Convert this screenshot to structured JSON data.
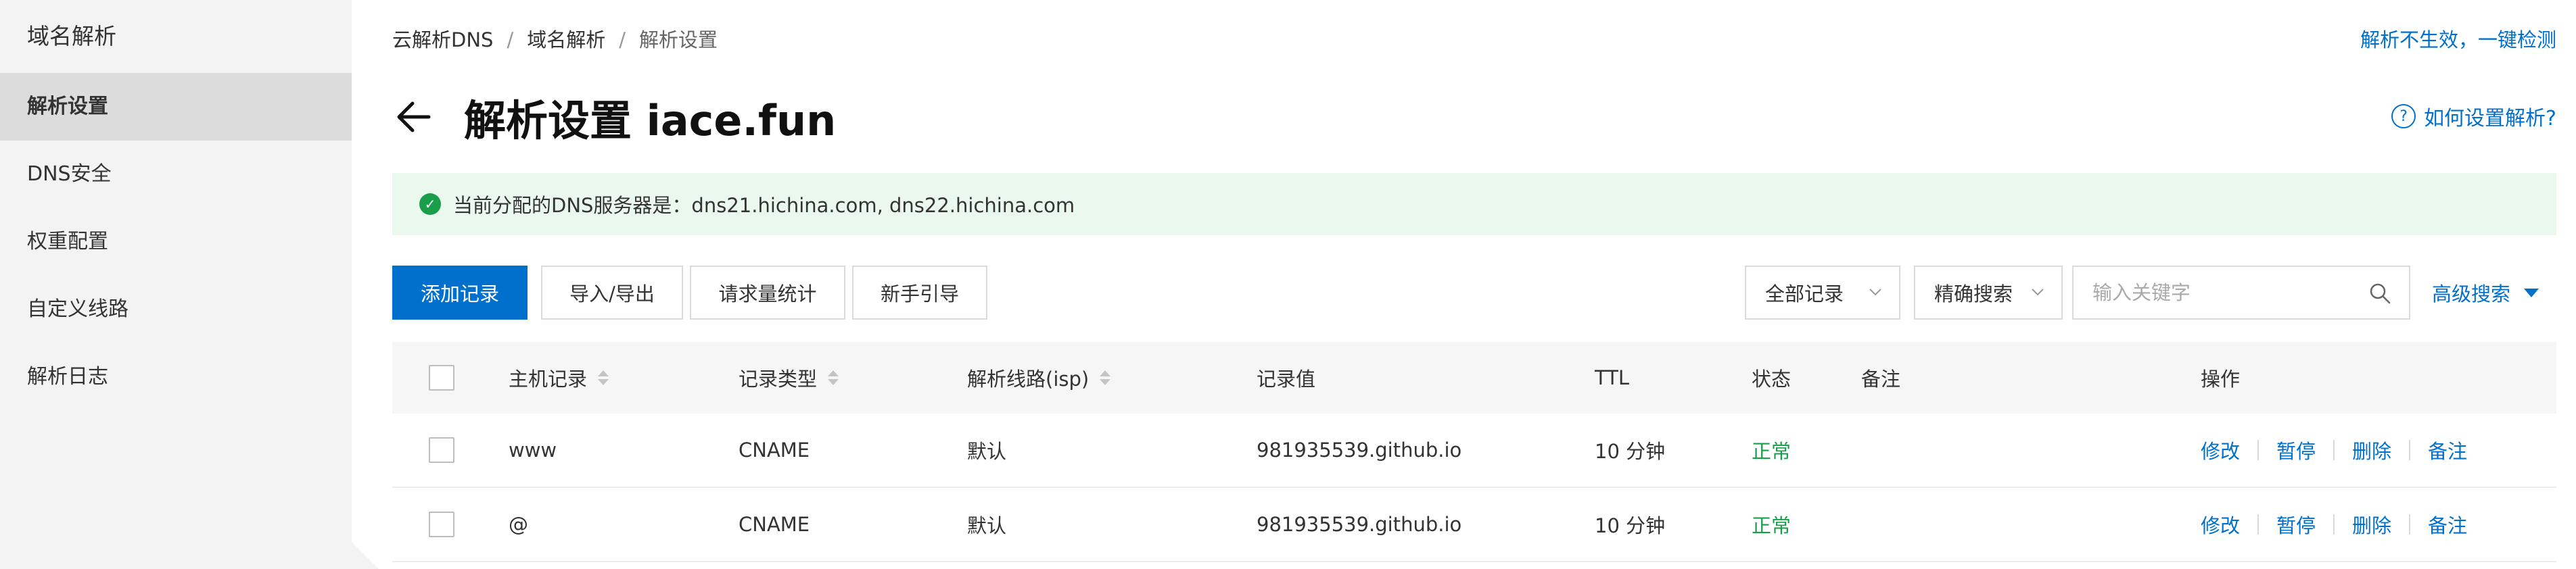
{
  "sidebar": {
    "title": "域名解析",
    "items": [
      {
        "label": "解析设置",
        "active": true
      },
      {
        "label": "DNS安全",
        "active": false
      },
      {
        "label": "权重配置",
        "active": false
      },
      {
        "label": "自定义线路",
        "active": false
      },
      {
        "label": "解析日志",
        "active": false
      }
    ]
  },
  "breadcrumb": {
    "items": [
      "云解析DNS",
      "域名解析",
      "解析设置"
    ],
    "separator": "/"
  },
  "header": {
    "check_link": "解析不生效，一键检测",
    "title": "解析设置 iace.fun",
    "help_icon": "?",
    "help_link": "如何设置解析?",
    "back_icon": "arrow-left-icon"
  },
  "notice": {
    "icon": "check-circle-icon",
    "icon_glyph": "✓",
    "text": "当前分配的DNS服务器是：dns21.hichina.com, dns22.hichina.com"
  },
  "toolbar": {
    "add": "添加记录",
    "import_export": "导入/导出",
    "stats": "请求量统计",
    "guide": "新手引导",
    "record_filter": "全部记录",
    "search_mode": "精确搜索",
    "search_placeholder": "输入关键字",
    "search_value": "",
    "advanced": "高级搜索"
  },
  "table": {
    "columns": {
      "host": "主机记录",
      "type": "记录类型",
      "line": "解析线路(isp)",
      "value": "记录值",
      "ttl": "TTL",
      "status": "状态",
      "remark": "备注",
      "actions": "操作"
    },
    "rows": [
      {
        "host": "www",
        "type": "CNAME",
        "line": "默认",
        "value": "981935539.github.io",
        "ttl": "10 分钟",
        "status": "正常",
        "remark": ""
      },
      {
        "host": "@",
        "type": "CNAME",
        "line": "默认",
        "value": "981935539.github.io",
        "ttl": "10 分钟",
        "status": "正常",
        "remark": ""
      }
    ],
    "actions": [
      "修改",
      "暂停",
      "删除",
      "备注"
    ]
  },
  "colors": {
    "accent": "#0070cc",
    "success": "#1a9e4a",
    "notice_bg": "#ebf8ee",
    "sidebar_bg": "#f3f3f3"
  }
}
